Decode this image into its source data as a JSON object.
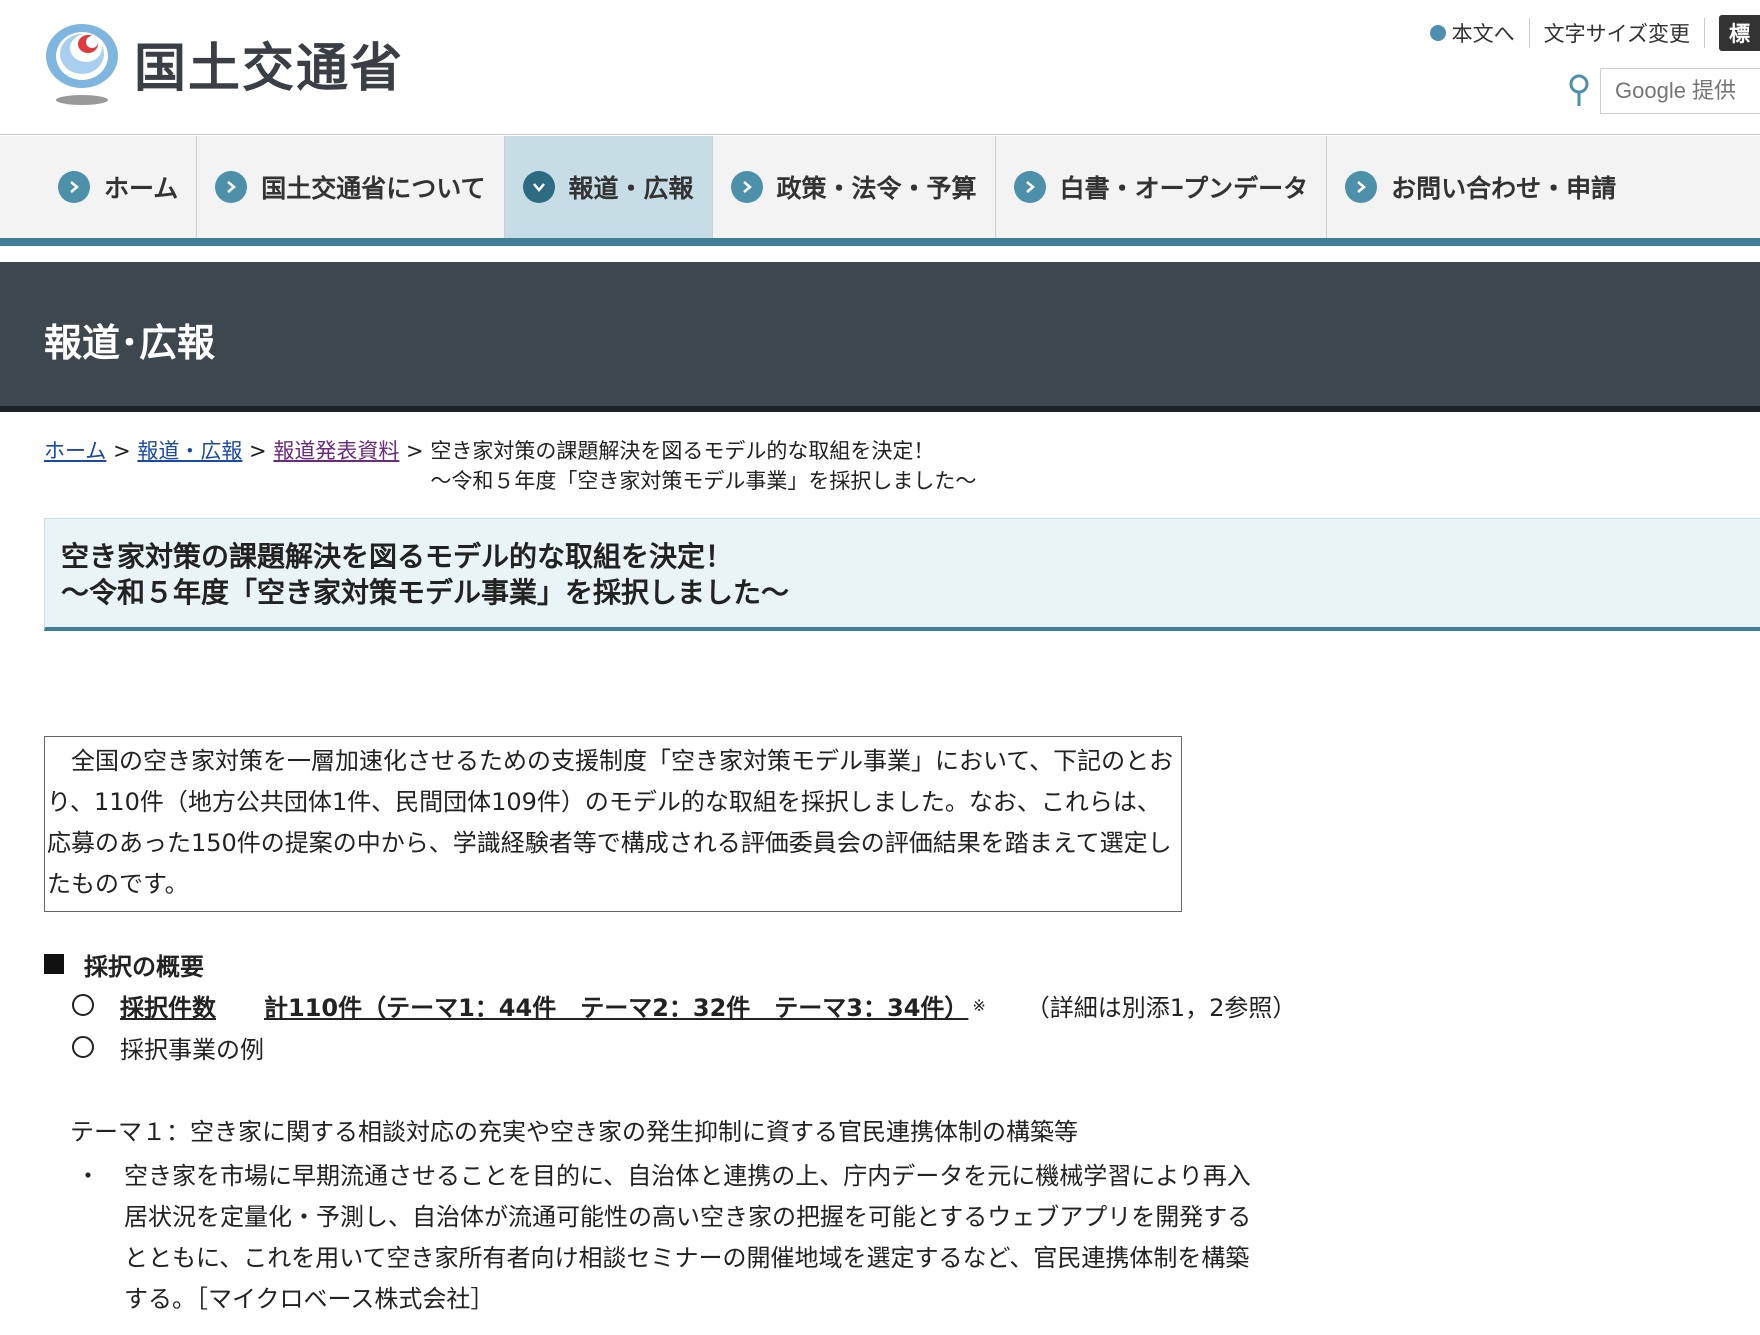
{
  "header": {
    "site_name": "国土交通省",
    "skip_link": "本文へ",
    "font_size_label": "文字サイズ変更",
    "standard_label": "標",
    "search_placeholder": "Google 提供"
  },
  "nav": {
    "items": [
      {
        "label": "ホーム",
        "active": false
      },
      {
        "label": "国土交通省について",
        "active": false
      },
      {
        "label": "報道・広報",
        "active": true
      },
      {
        "label": "政策・法令・予算",
        "active": false
      },
      {
        "label": "白書・オープンデータ",
        "active": false
      },
      {
        "label": "お問い合わせ・申請",
        "active": false
      }
    ]
  },
  "banner": {
    "title": "報道･広報"
  },
  "breadcrumb": {
    "items": [
      "ホーム",
      "報道・広報",
      "報道発表資料"
    ],
    "separator": ">",
    "current_line1": "空き家対策の課題解決を図るモデル的な取組を決定！",
    "current_line2": "～令和５年度「空き家対策モデル事業」を採択しました～"
  },
  "title": {
    "line1": "空き家対策の課題解決を図るモデル的な取組を決定！",
    "line2": "～令和５年度「空き家対策モデル事業」を採択しました～"
  },
  "intro": {
    "text": "　全国の空き家対策を一層加速化させるための支援制度「空き家対策モデル事業」において、下記のとおり、110件（地方公共団体1件、民間団体109件）のモデル的な取組を採択しました。なお、これらは、応募のあった150件の提案の中から、学識経験者等で構成される評価委員会の評価結果を踏まえて選定したものです。"
  },
  "summary": {
    "heading": "採択の概要",
    "count_label": "採択件数",
    "count_value": "計110件（テーマ1：44件　テーマ2：32件　テーマ3：34件）",
    "note_mark": "※",
    "detail": "（詳細は別添1，2参照）",
    "example_label": "採択事業の例"
  },
  "theme1": {
    "title": "テーマ１：空き家に関する相談対応の充実や空き家の発生抑制に資する官民連携体制の構築等",
    "bullet_mark": "・",
    "bullet_text": "空き家を市場に早期流通させることを目的に、自治体と連携の上、庁内データを元に機械学習により再入居状況を定量化・予測し、自治体が流通可能性の高い空き家の把握を可能とするウェブアプリを開発するとともに、これを用いて空き家所有者向け相談セミナーの開催地域を選定するなど、官民連携体制を構築する。［マイクロベース株式会社］"
  },
  "colors": {
    "nav_accent": "#3f7f95",
    "banner_bg": "#3f474e",
    "active_nav_bg": "#c6dde5",
    "title_bg": "#eaf4f7"
  }
}
